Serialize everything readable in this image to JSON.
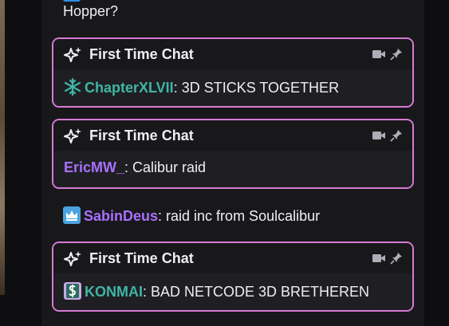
{
  "fragment_text": "Hopper?",
  "colors": {
    "card_border": "#d77ad5",
    "user_teal": "#3fb5a5",
    "user_purple": "#a970ff",
    "user_purple2": "#a970ff",
    "user_teal2": "#3fb5a5"
  },
  "cards": [
    {
      "title": "First Time Chat",
      "badge_icon": "snowflake-icon",
      "username": "ChapterXLVII",
      "message": ": 3D STICKS TOGETHER"
    },
    {
      "title": "First Time Chat",
      "badge_icon": "",
      "username": "EricMW_",
      "message": ": Calibur raid"
    },
    {
      "title": "First Time Chat",
      "badge_icon": "dollar-badge-icon",
      "username": "KONMAI",
      "message": ": BAD NETCODE 3D BRETHEREN"
    }
  ],
  "plain_message": {
    "badge_icon": "crown-icon",
    "username": "SabinDeus",
    "message": ": raid inc from Soulcalibur"
  }
}
